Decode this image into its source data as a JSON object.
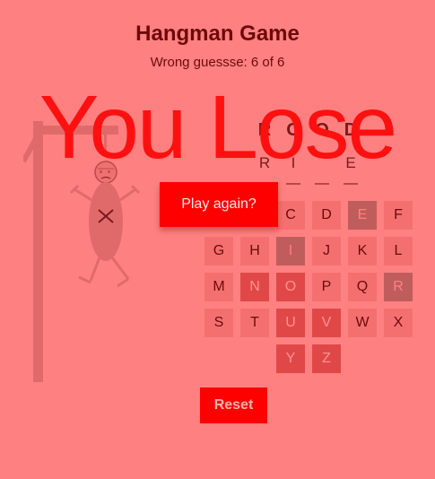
{
  "header": {
    "title": "Hangman Game",
    "status": "Wrong guessse: 6 of 6"
  },
  "word": {
    "solution_letters": [
      "R",
      "O",
      "O",
      "D"
    ],
    "guessed_letters": [
      "R",
      "I",
      "",
      "E"
    ],
    "blanks": [
      "",
      "—",
      "—",
      "—"
    ]
  },
  "keyboard": {
    "keys": [
      {
        "letter": "C",
        "state": "unused"
      },
      {
        "letter": "D",
        "state": "unused"
      },
      {
        "letter": "E",
        "state": "wrong"
      },
      {
        "letter": "F",
        "state": "unused"
      },
      {
        "letter": "G",
        "state": "unused"
      },
      {
        "letter": "H",
        "state": "unused"
      },
      {
        "letter": "I",
        "state": "wrong"
      },
      {
        "letter": "J",
        "state": "unused"
      },
      {
        "letter": "K",
        "state": "unused"
      },
      {
        "letter": "L",
        "state": "unused"
      },
      {
        "letter": "M",
        "state": "unused"
      },
      {
        "letter": "N",
        "state": "right"
      },
      {
        "letter": "O",
        "state": "right"
      },
      {
        "letter": "P",
        "state": "unused"
      },
      {
        "letter": "Q",
        "state": "unused"
      },
      {
        "letter": "R",
        "state": "wrong"
      },
      {
        "letter": "S",
        "state": "unused"
      },
      {
        "letter": "T",
        "state": "unused"
      },
      {
        "letter": "U",
        "state": "right"
      },
      {
        "letter": "V",
        "state": "right"
      },
      {
        "letter": "W",
        "state": "unused"
      },
      {
        "letter": "X",
        "state": "unused"
      },
      {
        "letter": "Y",
        "state": "right"
      },
      {
        "letter": "Z",
        "state": "right"
      }
    ]
  },
  "overlay": {
    "result_text": "You Lose",
    "play_again_label": "Play again?"
  },
  "controls": {
    "reset_label": "Reset"
  },
  "colors": {
    "background": "#ff8080",
    "accent": "#ff0000",
    "key_unused": "#f47070",
    "key_wrong": "#bf5d5d",
    "key_right": "#e04848"
  }
}
